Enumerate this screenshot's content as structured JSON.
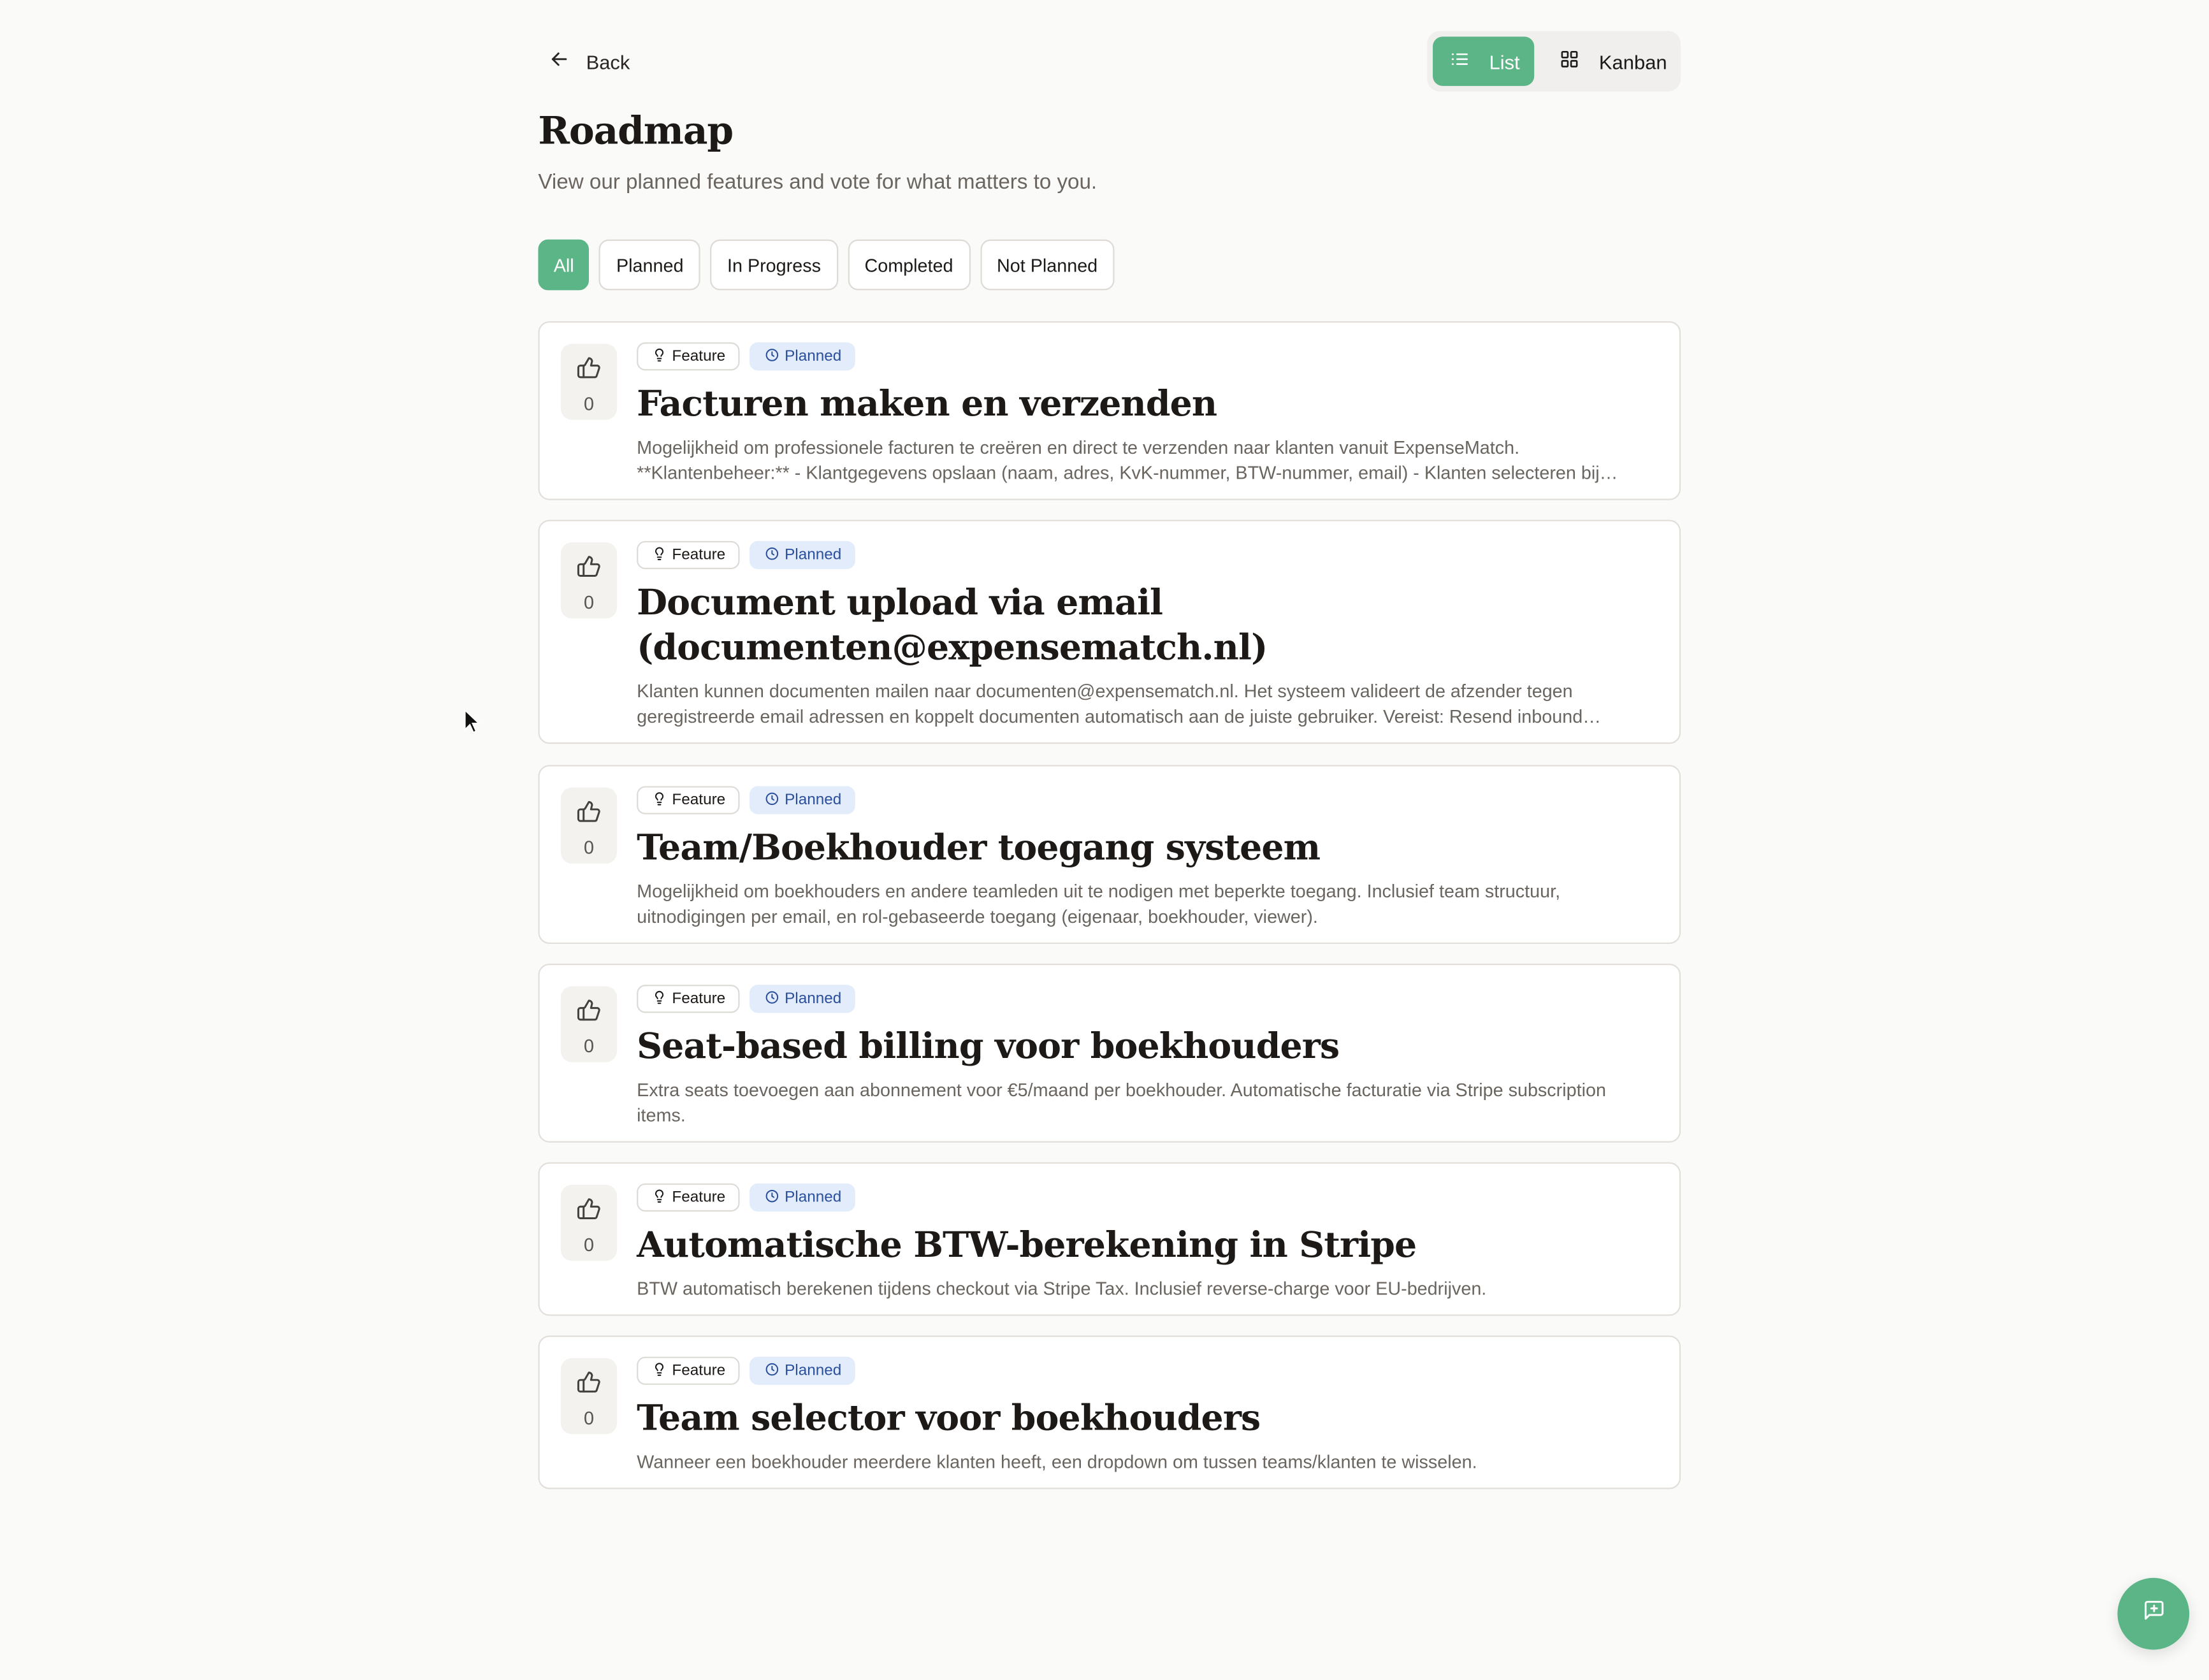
{
  "header": {
    "back_label": "Back",
    "view_toggle": {
      "list_label": "List",
      "kanban_label": "Kanban",
      "active": "List"
    }
  },
  "page": {
    "title": "Roadmap",
    "subtitle": "View our planned features and vote for what matters to you."
  },
  "filters": [
    {
      "label": "All",
      "active": true
    },
    {
      "label": "Planned",
      "active": false
    },
    {
      "label": "In Progress",
      "active": false
    },
    {
      "label": "Completed",
      "active": false
    },
    {
      "label": "Not Planned",
      "active": false
    }
  ],
  "items": [
    {
      "votes": "0",
      "type": "Feature",
      "status": "Planned",
      "title": "Facturen maken en verzenden",
      "description": "Mogelijkheid om professionele facturen te creëren en direct te verzenden naar klanten vanuit ExpenseMatch. **Klantenbeheer:** - Klantgegevens opslaan (naam, adres, KvK-nummer, BTW-nummer, email) - Klanten selecteren bij facturatie"
    },
    {
      "votes": "0",
      "type": "Feature",
      "status": "Planned",
      "title": "Document upload via email (documenten@expensematch.nl)",
      "description": "Klanten kunnen documenten mailen naar documenten@expensematch.nl. Het systeem valideert de afzender tegen geregistreerde email adressen en koppelt documenten automatisch aan de juiste gebruiker. Vereist: Resend inbound webhook configuratie."
    },
    {
      "votes": "0",
      "type": "Feature",
      "status": "Planned",
      "title": "Team/Boekhouder toegang systeem",
      "description": "Mogelijkheid om boekhouders en andere teamleden uit te nodigen met beperkte toegang. Inclusief team structuur, uitnodigingen per email, en rol-gebaseerde toegang (eigenaar, boekhouder, viewer)."
    },
    {
      "votes": "0",
      "type": "Feature",
      "status": "Planned",
      "title": "Seat-based billing voor boekhouders",
      "description": "Extra seats toevoegen aan abonnement voor €5/maand per boekhouder. Automatische facturatie via Stripe subscription items."
    },
    {
      "votes": "0",
      "type": "Feature",
      "status": "Planned",
      "title": "Automatische BTW-berekening in Stripe",
      "description": "BTW automatisch berekenen tijdens checkout via Stripe Tax. Inclusief reverse-charge voor EU-bedrijven."
    },
    {
      "votes": "0",
      "type": "Feature",
      "status": "Planned",
      "title": "Team selector voor boekhouders",
      "description": "Wanneer een boekhouder meerdere klanten heeft, een dropdown om tussen teams/klanten te wisselen."
    }
  ],
  "icons": {
    "back": "arrow-left-icon",
    "list": "list-icon",
    "kanban": "grid-icon",
    "vote": "thumbs-up-icon",
    "type": "lightbulb-icon",
    "status": "clock-icon",
    "chat": "message-plus-icon"
  },
  "colors": {
    "accent": "#5cb587",
    "status_badge_bg": "#e3ecfb",
    "status_badge_text": "#2a4f9c",
    "background": "#fafaf9"
  }
}
